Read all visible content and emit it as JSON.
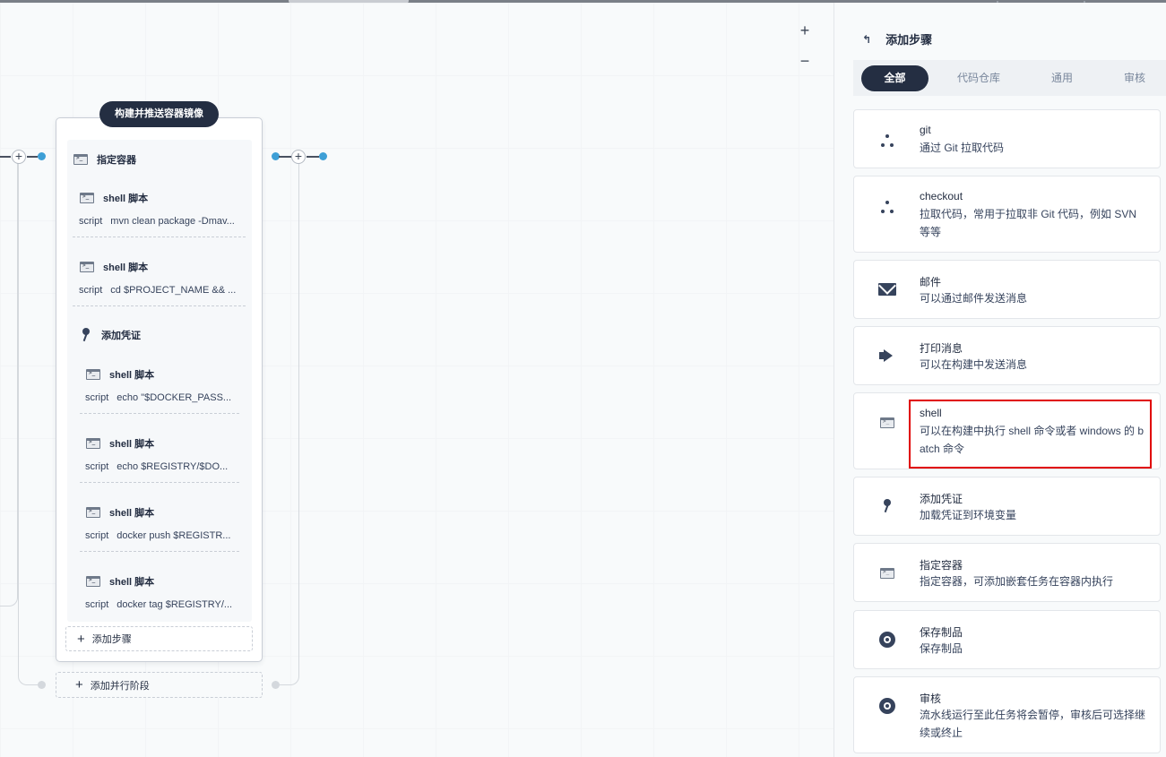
{
  "canvas": {
    "zoom_in_label": "+",
    "zoom_out_label": "−",
    "connector_plus": "+"
  },
  "stage": {
    "title": "构建并推送容器镜像",
    "container_step": "指定容器",
    "credential_step": "添加凭证",
    "steps": [
      {
        "title": "shell 脚本",
        "key": "script",
        "value": "mvn clean package -Dmav..."
      },
      {
        "title": "shell 脚本",
        "key": "script",
        "value": "cd $PROJECT_NAME && ..."
      },
      {
        "title": "shell 脚本",
        "key": "script",
        "value": "echo \"$DOCKER_PASS..."
      },
      {
        "title": "shell 脚本",
        "key": "script",
        "value": "echo $REGISTRY/$DO..."
      },
      {
        "title": "shell 脚本",
        "key": "script",
        "value": "docker push $REGISTR..."
      },
      {
        "title": "shell 脚本",
        "key": "script",
        "value": "docker tag $REGISTRY/..."
      }
    ],
    "add_step_label": "添加步骤",
    "add_parallel_label": "添加并行阶段",
    "add_plus": "+"
  },
  "panel": {
    "back_icon": "↰",
    "title": "添加步骤",
    "tabs": [
      "全部",
      "代码仓库",
      "通用",
      "审核"
    ],
    "active_tab": 0,
    "cards": [
      {
        "icon": "git-branch-icon",
        "title": "git",
        "desc": "通过 Git 拉取代码"
      },
      {
        "icon": "git-branch-icon",
        "title": "checkout",
        "desc": "拉取代码，常用于拉取非 Git 代码，例如 SVN 等等"
      },
      {
        "icon": "mail-icon",
        "title": "邮件",
        "desc": "可以通过邮件发送消息"
      },
      {
        "icon": "megaphone-icon",
        "title": "打印消息",
        "desc": "可以在构建中发送消息"
      },
      {
        "icon": "terminal-icon",
        "title": "shell",
        "desc": "可以在构建中执行 shell 命令或者 windows 的 batch 命令"
      },
      {
        "icon": "key-icon",
        "title": "添加凭证",
        "desc": "加载凭证到环境变量"
      },
      {
        "icon": "terminal-icon",
        "title": "指定容器",
        "desc": "指定容器，可添加嵌套任务在容器内执行"
      },
      {
        "icon": "disc-icon",
        "title": "保存制品",
        "desc": "保存制品"
      },
      {
        "icon": "disc-icon",
        "title": "审核",
        "desc": "流水线运行至此任务将会暂停，审核后可选择继续或终止"
      }
    ]
  },
  "colors": {
    "accent_dark": "#242e42",
    "connector_blue": "#3e9fd6",
    "highlight_red": "#e00000"
  }
}
